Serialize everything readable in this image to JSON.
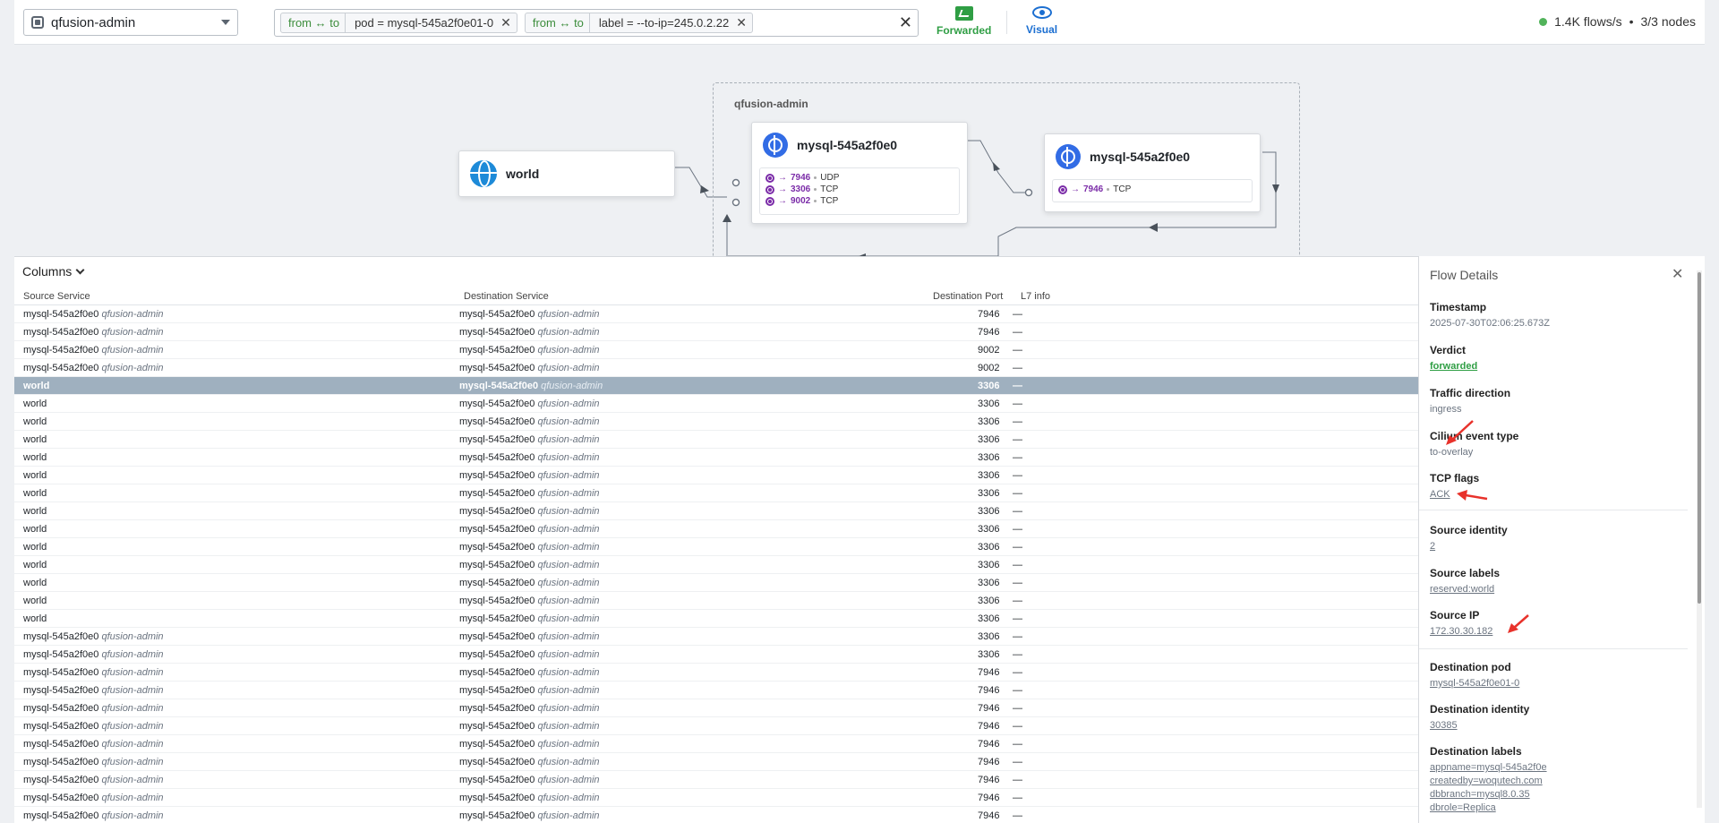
{
  "topbar": {
    "namespace": "qfusion-admin",
    "filters": [
      {
        "direction": "from ↔ to",
        "value": "pod = mysql-545a2f0e01-0"
      },
      {
        "direction": "from ↔ to",
        "value": "label = --to-ip=245.0.2.22"
      }
    ],
    "forwarded_label": "Forwarded",
    "visual_label": "Visual",
    "flows_rate": "1.4K flows/s",
    "separator": "•",
    "nodes": "3/3 nodes"
  },
  "map": {
    "namespace_label": "qfusion-admin",
    "world": {
      "title": "world"
    },
    "mysql_a": {
      "title": "mysql-545a2f0e0",
      "ports": [
        {
          "port": "7946",
          "proto": "UDP"
        },
        {
          "port": "3306",
          "proto": "TCP"
        },
        {
          "port": "9002",
          "proto": "TCP"
        }
      ]
    },
    "mysql_b": {
      "title": "mysql-545a2f0e0",
      "ports": [
        {
          "port": "7946",
          "proto": "TCP"
        }
      ]
    }
  },
  "table": {
    "columns_button": "Columns",
    "headers": {
      "source": "Source Service",
      "destination": "Destination Service",
      "port": "Destination Port",
      "l7": "L7 info"
    },
    "rows": [
      {
        "src": "mysql-545a2f0e0",
        "src_ns": "qfusion-admin",
        "dst": "mysql-545a2f0e0",
        "dst_ns": "qfusion-admin",
        "port": "7946",
        "l7": "—",
        "selected": false
      },
      {
        "src": "mysql-545a2f0e0",
        "src_ns": "qfusion-admin",
        "dst": "mysql-545a2f0e0",
        "dst_ns": "qfusion-admin",
        "port": "7946",
        "l7": "—",
        "selected": false
      },
      {
        "src": "mysql-545a2f0e0",
        "src_ns": "qfusion-admin",
        "dst": "mysql-545a2f0e0",
        "dst_ns": "qfusion-admin",
        "port": "9002",
        "l7": "—",
        "selected": false
      },
      {
        "src": "mysql-545a2f0e0",
        "src_ns": "qfusion-admin",
        "dst": "mysql-545a2f0e0",
        "dst_ns": "qfusion-admin",
        "port": "9002",
        "l7": "—",
        "selected": false
      },
      {
        "src": "world",
        "src_ns": "",
        "dst": "mysql-545a2f0e0",
        "dst_ns": "qfusion-admin",
        "port": "3306",
        "l7": "—",
        "selected": true
      },
      {
        "src": "world",
        "src_ns": "",
        "dst": "mysql-545a2f0e0",
        "dst_ns": "qfusion-admin",
        "port": "3306",
        "l7": "—",
        "selected": false
      },
      {
        "src": "world",
        "src_ns": "",
        "dst": "mysql-545a2f0e0",
        "dst_ns": "qfusion-admin",
        "port": "3306",
        "l7": "—",
        "selected": false
      },
      {
        "src": "world",
        "src_ns": "",
        "dst": "mysql-545a2f0e0",
        "dst_ns": "qfusion-admin",
        "port": "3306",
        "l7": "—",
        "selected": false
      },
      {
        "src": "world",
        "src_ns": "",
        "dst": "mysql-545a2f0e0",
        "dst_ns": "qfusion-admin",
        "port": "3306",
        "l7": "—",
        "selected": false
      },
      {
        "src": "world",
        "src_ns": "",
        "dst": "mysql-545a2f0e0",
        "dst_ns": "qfusion-admin",
        "port": "3306",
        "l7": "—",
        "selected": false
      },
      {
        "src": "world",
        "src_ns": "",
        "dst": "mysql-545a2f0e0",
        "dst_ns": "qfusion-admin",
        "port": "3306",
        "l7": "—",
        "selected": false
      },
      {
        "src": "world",
        "src_ns": "",
        "dst": "mysql-545a2f0e0",
        "dst_ns": "qfusion-admin",
        "port": "3306",
        "l7": "—",
        "selected": false
      },
      {
        "src": "world",
        "src_ns": "",
        "dst": "mysql-545a2f0e0",
        "dst_ns": "qfusion-admin",
        "port": "3306",
        "l7": "—",
        "selected": false
      },
      {
        "src": "world",
        "src_ns": "",
        "dst": "mysql-545a2f0e0",
        "dst_ns": "qfusion-admin",
        "port": "3306",
        "l7": "—",
        "selected": false
      },
      {
        "src": "world",
        "src_ns": "",
        "dst": "mysql-545a2f0e0",
        "dst_ns": "qfusion-admin",
        "port": "3306",
        "l7": "—",
        "selected": false
      },
      {
        "src": "world",
        "src_ns": "",
        "dst": "mysql-545a2f0e0",
        "dst_ns": "qfusion-admin",
        "port": "3306",
        "l7": "—",
        "selected": false
      },
      {
        "src": "world",
        "src_ns": "",
        "dst": "mysql-545a2f0e0",
        "dst_ns": "qfusion-admin",
        "port": "3306",
        "l7": "—",
        "selected": false
      },
      {
        "src": "world",
        "src_ns": "",
        "dst": "mysql-545a2f0e0",
        "dst_ns": "qfusion-admin",
        "port": "3306",
        "l7": "—",
        "selected": false
      },
      {
        "src": "mysql-545a2f0e0",
        "src_ns": "qfusion-admin",
        "dst": "mysql-545a2f0e0",
        "dst_ns": "qfusion-admin",
        "port": "3306",
        "l7": "—",
        "selected": false
      },
      {
        "src": "mysql-545a2f0e0",
        "src_ns": "qfusion-admin",
        "dst": "mysql-545a2f0e0",
        "dst_ns": "qfusion-admin",
        "port": "3306",
        "l7": "—",
        "selected": false
      },
      {
        "src": "mysql-545a2f0e0",
        "src_ns": "qfusion-admin",
        "dst": "mysql-545a2f0e0",
        "dst_ns": "qfusion-admin",
        "port": "7946",
        "l7": "—",
        "selected": false
      },
      {
        "src": "mysql-545a2f0e0",
        "src_ns": "qfusion-admin",
        "dst": "mysql-545a2f0e0",
        "dst_ns": "qfusion-admin",
        "port": "7946",
        "l7": "—",
        "selected": false
      },
      {
        "src": "mysql-545a2f0e0",
        "src_ns": "qfusion-admin",
        "dst": "mysql-545a2f0e0",
        "dst_ns": "qfusion-admin",
        "port": "7946",
        "l7": "—",
        "selected": false
      },
      {
        "src": "mysql-545a2f0e0",
        "src_ns": "qfusion-admin",
        "dst": "mysql-545a2f0e0",
        "dst_ns": "qfusion-admin",
        "port": "7946",
        "l7": "—",
        "selected": false
      },
      {
        "src": "mysql-545a2f0e0",
        "src_ns": "qfusion-admin",
        "dst": "mysql-545a2f0e0",
        "dst_ns": "qfusion-admin",
        "port": "7946",
        "l7": "—",
        "selected": false
      },
      {
        "src": "mysql-545a2f0e0",
        "src_ns": "qfusion-admin",
        "dst": "mysql-545a2f0e0",
        "dst_ns": "qfusion-admin",
        "port": "7946",
        "l7": "—",
        "selected": false
      },
      {
        "src": "mysql-545a2f0e0",
        "src_ns": "qfusion-admin",
        "dst": "mysql-545a2f0e0",
        "dst_ns": "qfusion-admin",
        "port": "7946",
        "l7": "—",
        "selected": false
      },
      {
        "src": "mysql-545a2f0e0",
        "src_ns": "qfusion-admin",
        "dst": "mysql-545a2f0e0",
        "dst_ns": "qfusion-admin",
        "port": "7946",
        "l7": "—",
        "selected": false
      },
      {
        "src": "mysql-545a2f0e0",
        "src_ns": "qfusion-admin",
        "dst": "mysql-545a2f0e0",
        "dst_ns": "qfusion-admin",
        "port": "7946",
        "l7": "—",
        "selected": false
      }
    ]
  },
  "details": {
    "title": "Flow Details",
    "timestamp_label": "Timestamp",
    "timestamp": "2025-07-30T02:06:25.673Z",
    "verdict_label": "Verdict",
    "verdict": "forwarded",
    "direction_label": "Traffic direction",
    "direction": "ingress",
    "event_type_label": "Cilium event type",
    "event_type": "to-overlay",
    "tcp_flags_label": "TCP flags",
    "tcp_flags": "ACK",
    "source_identity_label": "Source identity",
    "source_identity": "2",
    "source_labels_label": "Source labels",
    "source_labels": "reserved:world",
    "source_ip_label": "Source IP",
    "source_ip": "172.30.30.182",
    "dest_pod_label": "Destination pod",
    "dest_pod": "mysql-545a2f0e01-0",
    "dest_identity_label": "Destination identity",
    "dest_identity": "30385",
    "dest_labels_label": "Destination labels",
    "dest_labels": [
      "appname=mysql-545a2f0e",
      "createdby=woqutech.com",
      "dbbranch=mysql8.0.35",
      "dbrole=Replica"
    ]
  },
  "colors": {
    "accent_green": "#2f9e44",
    "accent_blue": "#1c6fd1",
    "selected_row": "#9fb0bf",
    "port_purple": "#7b2ca8",
    "annotation_red": "#e8322b"
  }
}
